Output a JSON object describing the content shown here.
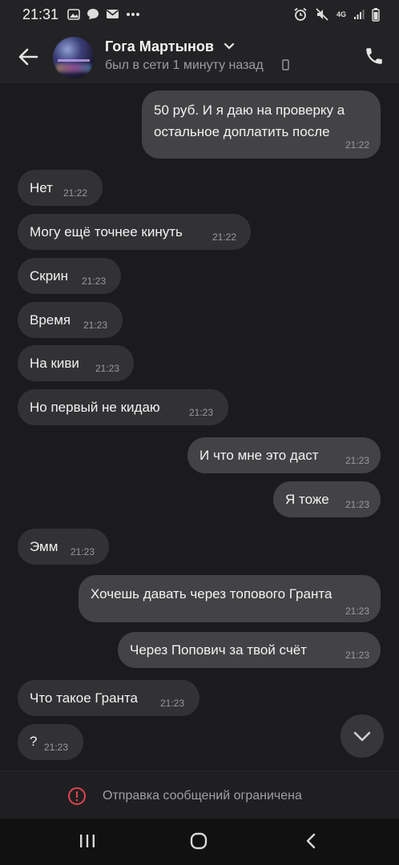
{
  "status_bar": {
    "time": "21:31",
    "network": "4G"
  },
  "header": {
    "contact_name": "Гога Мартынов",
    "last_seen": "был в сети 1 минуту назад"
  },
  "messages": [
    {
      "dir": "out",
      "text_lines": [
        "50 руб. И я даю на проверку а",
        "остальное доплатить после"
      ],
      "time": "21:22"
    },
    {
      "dir": "in",
      "text": "Нет",
      "time": "21:22"
    },
    {
      "dir": "in",
      "text": "Могу ещё точнее кинуть",
      "time": "21:22"
    },
    {
      "dir": "in",
      "text": "Скрин",
      "time": "21:23"
    },
    {
      "dir": "in",
      "text": "Время",
      "time": "21:23"
    },
    {
      "dir": "in",
      "text": "На киви",
      "time": "21:23"
    },
    {
      "dir": "in",
      "text": "Но первый не кидаю",
      "time": "21:23"
    },
    {
      "dir": "out",
      "text": "И что мне это даст",
      "time": "21:23"
    },
    {
      "dir": "out",
      "text": "Я тоже",
      "time": "21:23"
    },
    {
      "dir": "in",
      "text": "Эмм",
      "time": "21:23"
    },
    {
      "dir": "out",
      "text": "Хочешь давать через топового Гранта",
      "time": "21:23"
    },
    {
      "dir": "out",
      "text": "Через Попович за твой счёт",
      "time": "21:23"
    },
    {
      "dir": "in",
      "text": "Что такое Гранта",
      "time": "21:23"
    },
    {
      "dir": "in",
      "text": "?",
      "time": "21:23"
    }
  ],
  "composer": {
    "restricted_text": "Отправка сообщений ограничена"
  },
  "icons": {
    "back": "arrow-left-icon",
    "call": "phone-icon",
    "scroll_down": "chevron-down-icon",
    "restricted": "alert-circle-icon",
    "nav_recents": "recents-icon",
    "nav_home": "home-icon",
    "nav_back": "back-icon"
  },
  "colors": {
    "background": "#1b1b1d",
    "incoming_bubble": "#323235",
    "outgoing_bubble": "#434346",
    "alert": "#e0454f"
  }
}
